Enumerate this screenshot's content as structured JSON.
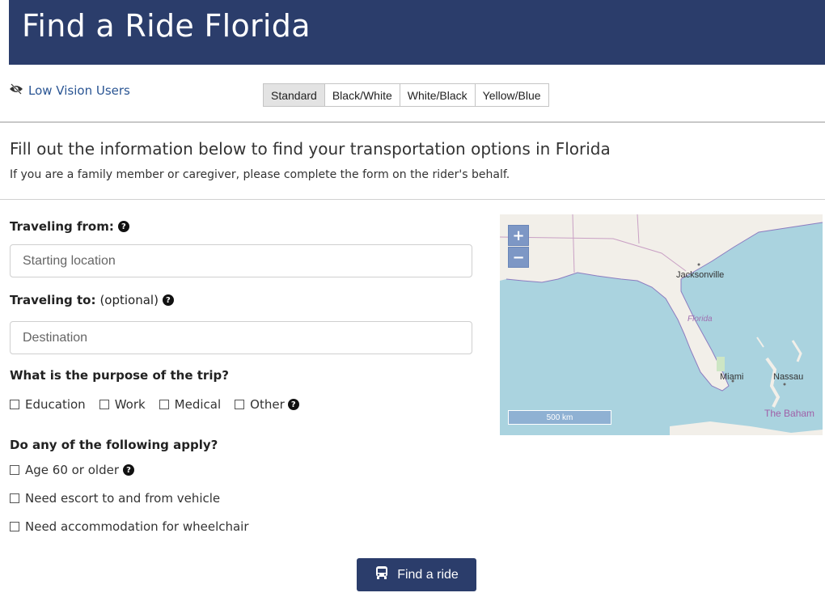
{
  "header": {
    "title": "Find a Ride Florida"
  },
  "low_vision": {
    "label": "Low Vision Users",
    "themes": [
      "Standard",
      "Black/White",
      "White/Black",
      "Yellow/Blue"
    ],
    "active_theme": "Standard"
  },
  "intro": {
    "title": "Fill out the information below to find your transportation options in Florida",
    "subtitle": "If you are a family member or caregiver, please complete the form on the rider's behalf."
  },
  "form": {
    "from_label": "Traveling from:",
    "from_placeholder": "Starting location",
    "from_value": "",
    "to_label": "Traveling to:",
    "to_optional": "(optional)",
    "to_placeholder": "Destination",
    "to_value": "",
    "purpose_label": "What is the purpose of the trip?",
    "purpose_options": [
      "Education",
      "Work",
      "Medical",
      "Other"
    ],
    "apply_label": "Do any of the following apply?",
    "apply_options": [
      "Age 60 or older",
      "Need escort to and from vehicle",
      "Need accommodation for wheelchair"
    ],
    "submit_label": "Find a ride"
  },
  "map": {
    "zoom_in": "+",
    "zoom_out": "−",
    "scale_label": "500 km",
    "place_labels": [
      "Jacksonville",
      "Florida",
      "Miami",
      "Nassau",
      "The Baham"
    ]
  },
  "colors": {
    "header_bg": "#2b3d6b",
    "link": "#2a5593",
    "button_bg": "#2b3d6b",
    "map_water": "#aad3df",
    "map_land": "#f2efe9"
  }
}
